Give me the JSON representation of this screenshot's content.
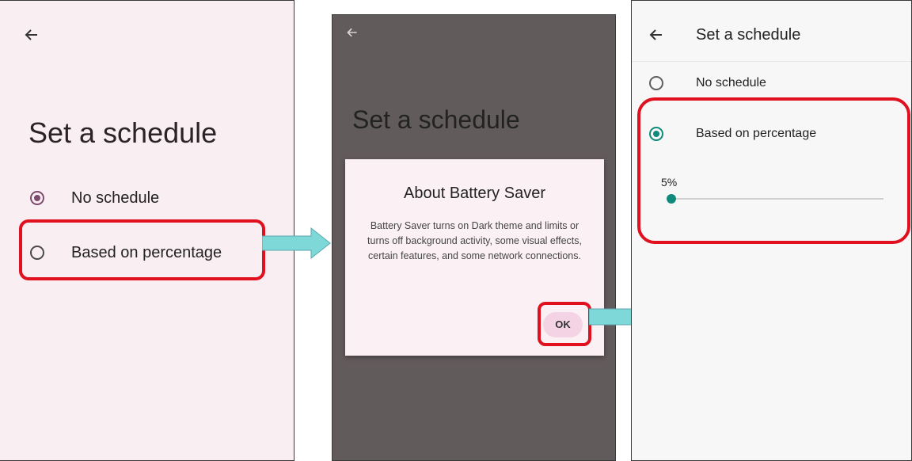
{
  "screen1": {
    "title": "Set a schedule",
    "options": [
      "No schedule",
      "Based on percentage"
    ],
    "selected_index": 0
  },
  "screen2": {
    "title": "Set a schedule",
    "dialog": {
      "title": "About Battery Saver",
      "body": "Battery Saver turns on Dark theme and limits or turns off background activity, some visual effects, certain features, and some network connections.",
      "ok_label": "OK"
    }
  },
  "screen3": {
    "title": "Set a schedule",
    "options": [
      "No schedule",
      "Based on percentage"
    ],
    "selected_index": 1,
    "slider_value_label": "5%",
    "slider_fraction": 0.05
  },
  "colors": {
    "highlight_box": "#e0101f",
    "flow_arrow": "#7fd8d8",
    "radio_selected_screen1": "#7d4a6c",
    "radio_selected_screen3": "#0f8a7b"
  }
}
